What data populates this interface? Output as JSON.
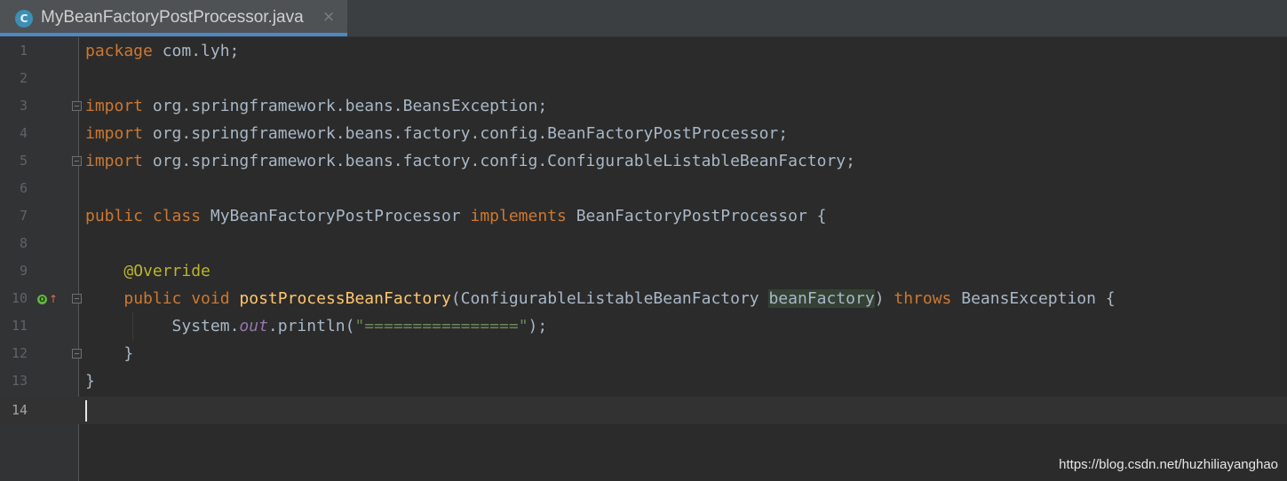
{
  "tab": {
    "icon": "C",
    "title": "MyBeanFactoryPostProcessor.java",
    "close": "×"
  },
  "lines": [
    {
      "n": "1"
    },
    {
      "n": "2"
    },
    {
      "n": "3"
    },
    {
      "n": "4"
    },
    {
      "n": "5"
    },
    {
      "n": "6"
    },
    {
      "n": "7"
    },
    {
      "n": "8"
    },
    {
      "n": "9"
    },
    {
      "n": "10"
    },
    {
      "n": "11"
    },
    {
      "n": "12"
    },
    {
      "n": "13"
    },
    {
      "n": "14"
    }
  ],
  "code": {
    "l1": {
      "kw": "package",
      "rest": " com.lyh;"
    },
    "l3": {
      "kw": "import",
      "rest": " org.springframework.beans.BeansException;"
    },
    "l4": {
      "kw": "import",
      "rest": " org.springframework.beans.factory.config.BeanFactoryPostProcessor;"
    },
    "l5": {
      "kw": "import",
      "rest": " org.springframework.beans.factory.config.ConfigurableListableBeanFactory;"
    },
    "l7": {
      "kw1": "public class",
      "name": " MyBeanFactoryPostProcessor ",
      "kw2": "implements",
      "rest": " BeanFactoryPostProcessor {"
    },
    "l9": {
      "ann": "@Override"
    },
    "l10": {
      "kw1": "public void",
      "fn": "postProcessBeanFactory",
      "p1": "(ConfigurableListableBeanFactory ",
      "param": "beanFactory",
      "p2": ") ",
      "kw2": "throws",
      "rest": " BeansException {"
    },
    "l11": {
      "a": "System.",
      "fld": "out",
      "b": ".println(",
      "str": "\"================\"",
      "c": ");"
    },
    "l12": {
      "text": "}"
    },
    "l13": {
      "text": "}"
    }
  },
  "gutter_icons": {
    "override": "O",
    "arrow": "↑"
  },
  "watermark": "https://blog.csdn.net/huzhiliayanghao",
  "colors": {
    "background": "#2b2b2b",
    "keyword": "#cc7832",
    "annotation": "#bbb529",
    "method": "#ffc66d",
    "string": "#6a8759",
    "field": "#9876aa",
    "text": "#a9b7c6",
    "tab_underline": "#4a88c7"
  }
}
